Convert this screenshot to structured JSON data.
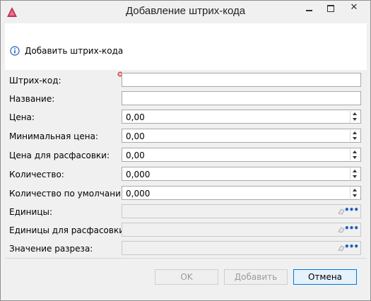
{
  "window": {
    "title": "Добавление штрих-кода",
    "close_glyph": "✕"
  },
  "header": {
    "text": "Добавить штрих-кода"
  },
  "fields": [
    {
      "label": "Штрих-код:",
      "value": "",
      "type": "text",
      "error": true
    },
    {
      "label": "Название:",
      "value": "",
      "type": "text"
    },
    {
      "label": "Цена:",
      "value": "0,00",
      "type": "spin"
    },
    {
      "label": "Минимальная цена:",
      "value": "0,00",
      "type": "spin"
    },
    {
      "label": "Цена для расфасовки:",
      "value": "0,00",
      "type": "spin"
    },
    {
      "label": "Количество:",
      "value": "0,000",
      "type": "spin"
    },
    {
      "label": "Количество по умолчанию:",
      "value": "0,000",
      "type": "spin"
    },
    {
      "label": "Единицы:",
      "value": "",
      "type": "picker"
    },
    {
      "label": "Единицы для расфасовки:",
      "value": "",
      "type": "picker"
    },
    {
      "label": "Значение разреза:",
      "value": "",
      "type": "picker"
    }
  ],
  "picker_glyph": "•••",
  "buttons": {
    "ok": "OK",
    "add": "Добавить",
    "cancel": "Отмена"
  },
  "colors": {
    "accent": "#0078d7",
    "error": "#d9534f",
    "info": "#1f5fbf",
    "logo": "#c0305a"
  }
}
